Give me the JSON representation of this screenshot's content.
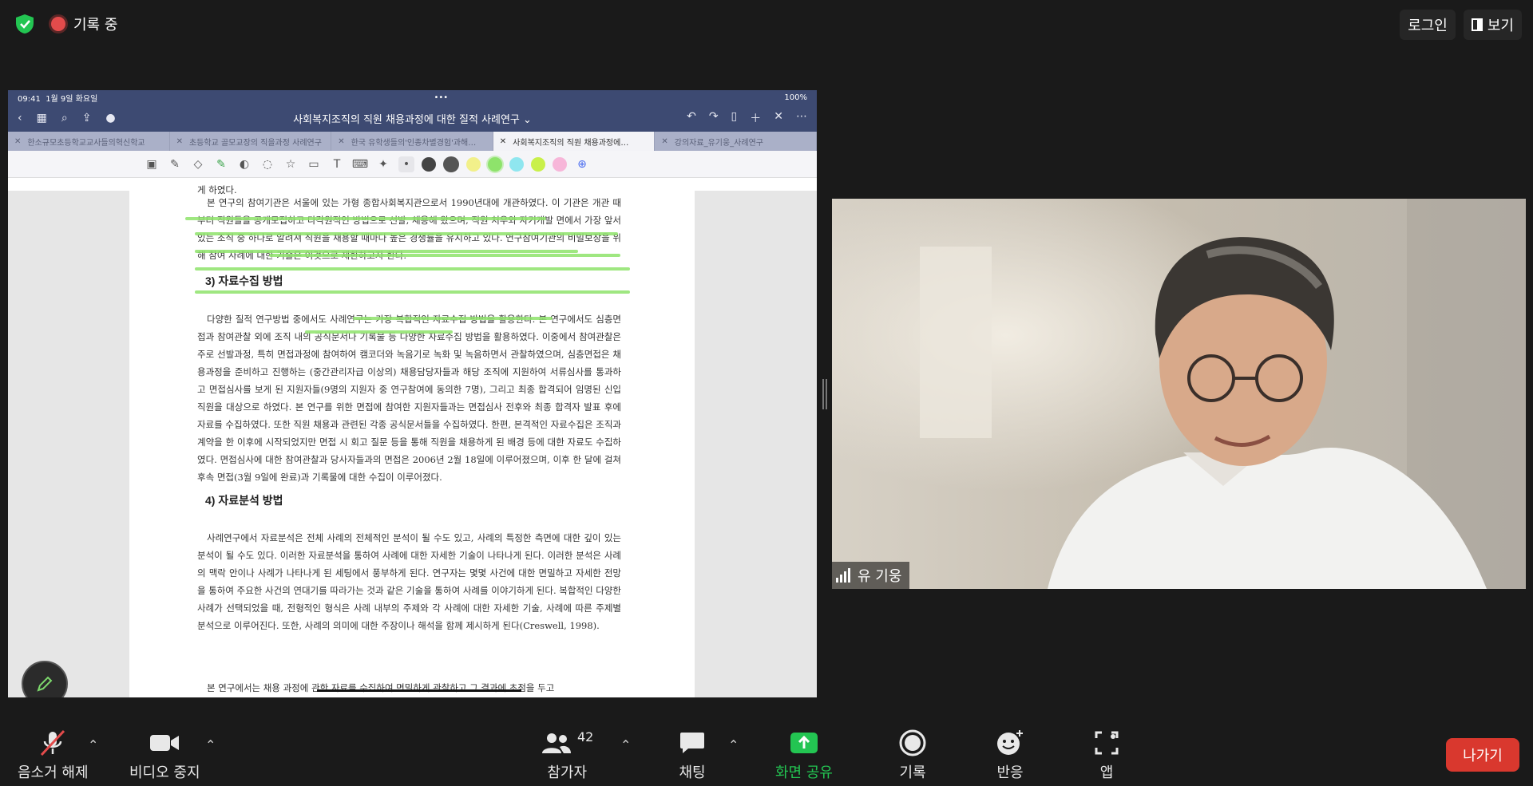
{
  "top_bar": {
    "recording_label": "기록 중",
    "login_label": "로그인",
    "view_label": "보기"
  },
  "shared_screen": {
    "status_time": "09:41",
    "status_date": "1월 9일 화요일",
    "status_dots": "•••",
    "status_battery": "100%",
    "document_title": "사회복지조직의 직원 채용과정에 대한 질적 사례연구 ⌄",
    "tabs": [
      {
        "label": "한소규모초등학교교사들의혁신학교"
      },
      {
        "label": "초등학교 골모교장의 직을과정 사례연구"
      },
      {
        "label": "한국 유학생들의'인종차별경험'과해…"
      },
      {
        "label": "사회복지조직의 직원 채용과정에…"
      },
      {
        "label": "강의자료_유기웅_사례연구"
      }
    ],
    "colors": {
      "nav_bar": "#3d4a72",
      "highlighter": "#8ee36b"
    },
    "doc": {
      "para_intro_partial": "게 하였다.",
      "para_1": "본 연구의 참여기관은 서울에 있는 가형 종합사회복지관으로서 1990년대에 개관하였다. 이 기관은 개관 때부터 직원들을 공개모집하고 다각원적인 방법으로 선발, 채용해 왔으며, 직원 처우와 자기개발 면에서 가장 앞서있는 조직 중 하나로 알려져 직원을 채용할 때마다 높은 경쟁률을 유지하고 있다. 연구참여기관의 비밀보장을 위해 참여 사례에 대한 기술은 이것으로 제한하고자 한다.",
      "heading_3": "3) 자료수집 방법",
      "para_2": "다양한 질적 연구방법 중에서도 사례연구는 가장 복합적인 자료수집 방법을 활용한다. 본 연구에서도 심층면접과 참여관찰 외에 조직 내의 공식문서나 기록물 등 다양한 자료수집 방법을 활용하였다. 이중에서 참여관찰은 주로 선발과정, 특히 면접과정에 참여하여 캠코더와 녹음기로 녹화 및 녹음하면서 관찰하였으며, 심층면접은 채용과정을 준비하고 진행하는 (중간관리자급 이상의) 채용담당자들과 해당 조직에 지원하여 서류심사를 통과하고 면접심사를 보게 된 지원자들(9명의 지원자 중 연구참여에 동의한 7명), 그리고 최종 합격되어 임명된 신입직원을 대상으로 하였다. 본 연구를 위한 면접에 참여한 지원자들과는 면접심사 전후와 최종 합격자 발표 후에 자료를 수집하였다. 또한 직원 채용과 관련된 각종 공식문서들을 수집하였다. 한편, 본격적인 자료수집은 조직과 계약을 한 이후에 시작되었지만 면접 시 회고 질문 등을 통해 직원을 채용하게 된 배경 등에 대한 자료도 수집하였다. 면접심사에 대한 참여관찰과 당사자들과의 면접은 2006년 2월 18일에 이루어졌으며, 이후 한 달에 걸쳐 후속 면접(3월 9일에 완료)과 기록물에 대한 수집이 이루어졌다.",
      "heading_4": "4) 자료분석 방법",
      "para_3": "사례연구에서 자료분석은 전체 사례의 전체적인 분석이 될 수도 있고, 사례의 특정한 측면에 대한 깊이 있는 분석이 될 수도 있다. 이러한 자료분석을 통하여 사례에 대한 자세한 기술이 나타나게 된다. 이러한 분석은 사례의 맥락 안이나 사례가 나타나게 된 세팅에서 풍부하게 된다. 연구자는 몇몇 사건에 대한 면밀하고 자세한 전망을 통하여 주요한 사건의 연대기를 따라가는 것과 같은 기술을 통하여 사례를 이야기하게 된다. 복합적인 다양한 사례가 선택되었을 때, 전형적인 형식은 사례 내부의 주제와 각 사례에 대한 자세한 기술, 사례에 따른 주제별 분석으로 이루어진다. 또한, 사례의 의미에 대한 주장이나 해석을 함께 제시하게 된다(Creswell, 1998).",
      "para_4_partial": "본 연구에서는 채용 과정에 관한 자료를 수집하여 면밀하게 관찰하고 그 결과에 초점을 두고"
    }
  },
  "participant": {
    "name": "유 기웅"
  },
  "toolbar": {
    "unmute_label": "음소거 해제",
    "video_label": "비디오 중지",
    "participants_label": "참가자",
    "participants_count": "42",
    "chat_label": "채팅",
    "share_label": "화면 공유",
    "record_label": "기록",
    "reactions_label": "반응",
    "apps_label": "앱",
    "leave_label": "나가기",
    "colors": {
      "share_green": "#23c552",
      "leave_red": "#d9382e"
    }
  }
}
